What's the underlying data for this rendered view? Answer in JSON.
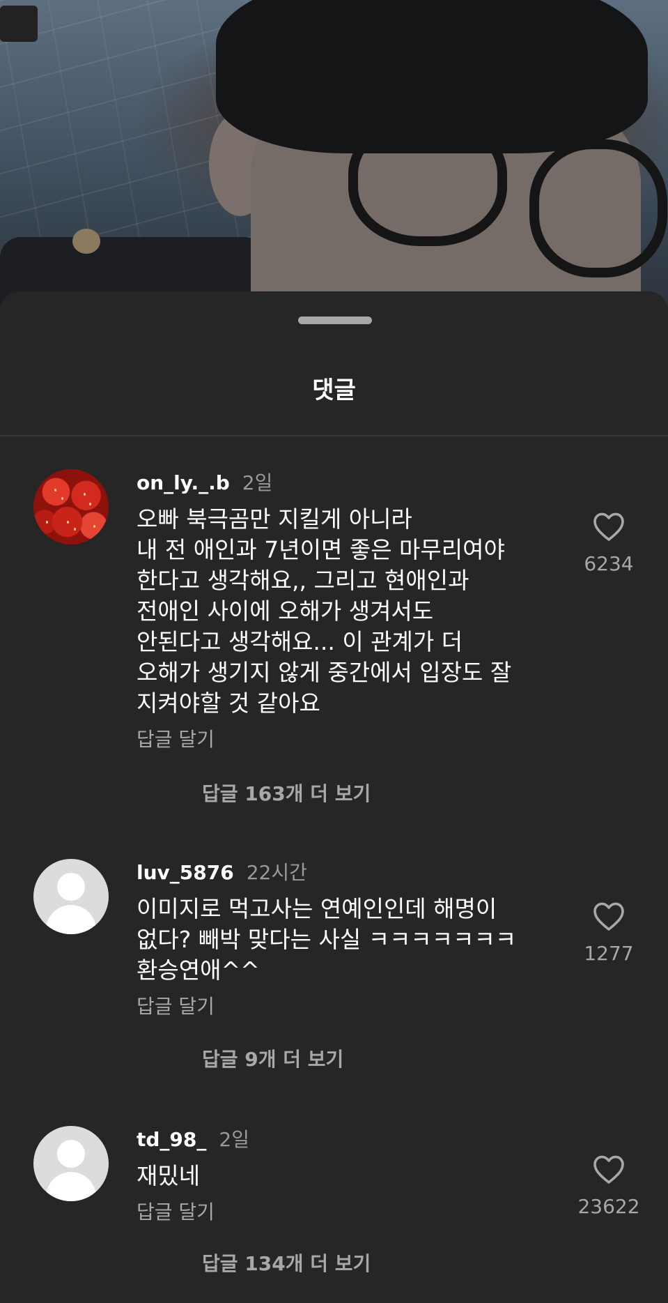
{
  "sheet": {
    "title": "댓글"
  },
  "comments": [
    {
      "username": "on_ly._.b",
      "time": "2일",
      "text": "오빠 북극곰만 지킬게 아니라\n내 전 애인과 7년이면 좋은 마무리여야\n한다고 생각해요,, 그리고 현애인과\n전애인 사이에 오해가 생겨서도\n안된다고 생각해요... 이 관계가 더\n오해가 생기지 않게 중간에서 입장도 잘\n지켜야할 것 같아요",
      "reply_label": "답글 달기",
      "more_replies": "답글 163개 더 보기",
      "likes": "6234",
      "avatar": "strawberries"
    },
    {
      "username": "luv_5876",
      "time": "22시간",
      "text": "이미지로 먹고사는 연예인인데 해명이\n없다? 빼박 맞다는 사실 ㅋㅋㅋㅋㅋㅋㅋ\n환승연애^^",
      "reply_label": "답글 달기",
      "more_replies": "답글 9개 더 보기",
      "likes": "1277",
      "avatar": "default"
    },
    {
      "username": "td_98_",
      "time": "2일",
      "text": "재밌네",
      "reply_label": "답글 달기",
      "more_replies": "답글 134개 더 보기",
      "likes": "23622",
      "avatar": "default"
    }
  ],
  "icons": {
    "like": "heart-outline-icon",
    "avatar_default": "person-silhouette-icon"
  },
  "colors": {
    "sheet_bg": "#262626",
    "text_primary": "#ffffff",
    "text_secondary": "#a8a8a8"
  }
}
